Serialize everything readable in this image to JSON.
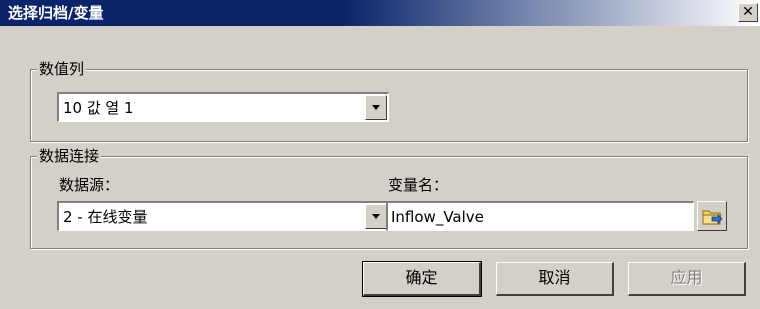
{
  "window": {
    "title": "选择归档/变量",
    "close_label": "✕"
  },
  "value_group": {
    "label": "数值列",
    "combo_value": "10  값 열 1"
  },
  "data_link_group": {
    "label": "数据连接",
    "source_label": "数据源：",
    "source_value": "2 - 在线变量",
    "tag_label": "变量名：",
    "tag_value": "Inflow_Valve"
  },
  "buttons": {
    "ok": "确定",
    "cancel": "取消",
    "apply": "应用"
  },
  "icons": {
    "browse": "folder-browse-icon",
    "dropdown": "chevron-down-icon",
    "close": "close-icon"
  }
}
